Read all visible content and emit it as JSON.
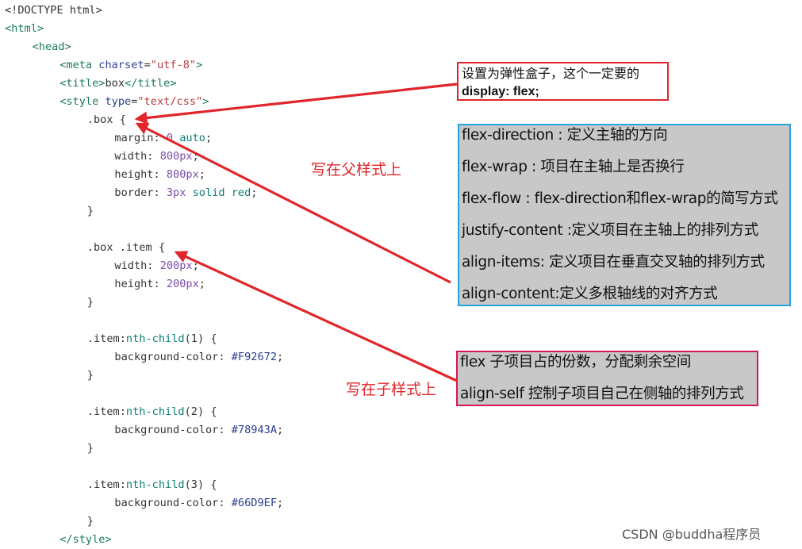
{
  "code_lines": [
    {
      "indent": 0,
      "tokens": [
        {
          "t": "<!DOCTYPE html>",
          "c": "punc"
        }
      ]
    },
    {
      "indent": 0,
      "tokens": [
        {
          "t": "<html>",
          "c": "tag"
        }
      ]
    },
    {
      "indent": 1,
      "tokens": [
        {
          "t": "<head>",
          "c": "tag"
        }
      ]
    },
    {
      "indent": 2,
      "tokens": [
        {
          "t": "<meta",
          "c": "tag"
        },
        {
          "t": " charset",
          "c": "attr"
        },
        {
          "t": "=",
          "c": "punc"
        },
        {
          "t": "\"utf-8\"",
          "c": "str"
        },
        {
          "t": ">",
          "c": "tag"
        }
      ]
    },
    {
      "indent": 2,
      "tokens": [
        {
          "t": "<title>",
          "c": "tag"
        },
        {
          "t": "box",
          "c": "punc"
        },
        {
          "t": "</title>",
          "c": "tag"
        }
      ]
    },
    {
      "indent": 2,
      "tokens": [
        {
          "t": "<style",
          "c": "tag"
        },
        {
          "t": " type",
          "c": "attr"
        },
        {
          "t": "=",
          "c": "punc"
        },
        {
          "t": "\"text/css\"",
          "c": "str"
        },
        {
          "t": ">",
          "c": "tag"
        }
      ]
    },
    {
      "indent": 3,
      "tokens": [
        {
          "t": ".box {",
          "c": "sel"
        }
      ]
    },
    {
      "indent": 4,
      "tokens": [
        {
          "t": "margin: ",
          "c": "prop"
        },
        {
          "t": "0 ",
          "c": "num"
        },
        {
          "t": "auto",
          "c": "val"
        },
        {
          "t": ";",
          "c": "punc"
        }
      ]
    },
    {
      "indent": 4,
      "tokens": [
        {
          "t": "width: ",
          "c": "prop"
        },
        {
          "t": "800px",
          "c": "num"
        },
        {
          "t": ";",
          "c": "punc"
        }
      ]
    },
    {
      "indent": 4,
      "tokens": [
        {
          "t": "height: ",
          "c": "prop"
        },
        {
          "t": "800px",
          "c": "num"
        },
        {
          "t": ";",
          "c": "punc"
        }
      ]
    },
    {
      "indent": 4,
      "tokens": [
        {
          "t": "border: ",
          "c": "prop"
        },
        {
          "t": "3px ",
          "c": "num"
        },
        {
          "t": "solid red",
          "c": "val"
        },
        {
          "t": ";",
          "c": "punc"
        }
      ]
    },
    {
      "indent": 3,
      "tokens": [
        {
          "t": "}",
          "c": "punc"
        }
      ]
    },
    {
      "indent": 0,
      "tokens": []
    },
    {
      "indent": 3,
      "tokens": [
        {
          "t": ".box .item {",
          "c": "sel"
        }
      ]
    },
    {
      "indent": 4,
      "tokens": [
        {
          "t": "width: ",
          "c": "prop"
        },
        {
          "t": "200px",
          "c": "num"
        },
        {
          "t": ";",
          "c": "punc"
        }
      ]
    },
    {
      "indent": 4,
      "tokens": [
        {
          "t": "height: ",
          "c": "prop"
        },
        {
          "t": "200px",
          "c": "num"
        },
        {
          "t": ";",
          "c": "punc"
        }
      ]
    },
    {
      "indent": 3,
      "tokens": [
        {
          "t": "}",
          "c": "punc"
        }
      ]
    },
    {
      "indent": 0,
      "tokens": []
    },
    {
      "indent": 3,
      "tokens": [
        {
          "t": ".item:",
          "c": "sel"
        },
        {
          "t": "nth-child",
          "c": "fn"
        },
        {
          "t": "(1) {",
          "c": "punc"
        }
      ]
    },
    {
      "indent": 4,
      "tokens": [
        {
          "t": "background-color: ",
          "c": "prop"
        },
        {
          "t": "#F92672",
          "c": "color"
        },
        {
          "t": ";",
          "c": "punc"
        }
      ]
    },
    {
      "indent": 3,
      "tokens": [
        {
          "t": "}",
          "c": "punc"
        }
      ]
    },
    {
      "indent": 0,
      "tokens": []
    },
    {
      "indent": 3,
      "tokens": [
        {
          "t": ".item:",
          "c": "sel"
        },
        {
          "t": "nth-child",
          "c": "fn"
        },
        {
          "t": "(2) {",
          "c": "punc"
        }
      ]
    },
    {
      "indent": 4,
      "tokens": [
        {
          "t": "background-color: ",
          "c": "prop"
        },
        {
          "t": "#78943A",
          "c": "color"
        },
        {
          "t": ";",
          "c": "punc"
        }
      ]
    },
    {
      "indent": 3,
      "tokens": [
        {
          "t": "}",
          "c": "punc"
        }
      ]
    },
    {
      "indent": 0,
      "tokens": []
    },
    {
      "indent": 3,
      "tokens": [
        {
          "t": ".item:",
          "c": "sel"
        },
        {
          "t": "nth-child",
          "c": "fn"
        },
        {
          "t": "(3) {",
          "c": "punc"
        }
      ]
    },
    {
      "indent": 4,
      "tokens": [
        {
          "t": "background-color: ",
          "c": "prop"
        },
        {
          "t": "#66D9EF",
          "c": "color"
        },
        {
          "t": ";",
          "c": "punc"
        }
      ]
    },
    {
      "indent": 3,
      "tokens": [
        {
          "t": "}",
          "c": "punc"
        }
      ]
    },
    {
      "indent": 2,
      "tokens": [
        {
          "t": "</style>",
          "c": "tag"
        }
      ]
    }
  ],
  "callout_display": {
    "line1": "设置为弹性盒子，这个一定要的",
    "line2": "display: flex;"
  },
  "parent_props": [
    "flex-direction : 定义主轴的方向",
    "flex-wrap : 项目在主轴上是否换行",
    "flex-flow : flex-direction和flex-wrap的简写方式",
    "justify-content :定义项目在主轴上的排列方式",
    "align-items: 定义项目在垂直交叉轴的排列方式",
    "align-content:定义多根轴线的对齐方式"
  ],
  "child_props": [
    "flex 子项目占的份数，分配剩余空间",
    "align-self 控制子项目自己在侧轴的排列方式"
  ],
  "note_parent": "写在父样式上",
  "note_child": "写在子样式上",
  "watermark": "CSDN @buddha程序员",
  "colors": {
    "arrow": "#e0262b",
    "parent_box_border": "#29a3dd",
    "child_box_border": "#d8175a",
    "callout_border": "#e0262b",
    "panel_fill": "#c8c8c8"
  }
}
